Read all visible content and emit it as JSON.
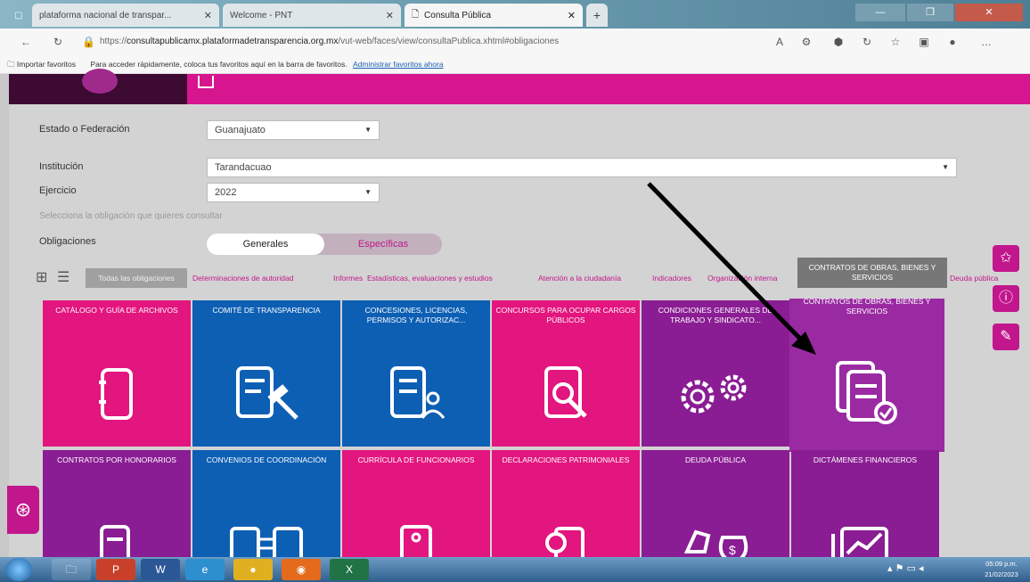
{
  "browser": {
    "tabs": [
      {
        "label": "plataforma nacional de transpar..."
      },
      {
        "label": "Welcome - PNT"
      },
      {
        "label": "Consulta Pública"
      }
    ],
    "url_prefix": "https://",
    "url_domain": "consultapublicamx.plataformadetransparencia.org.mx",
    "url_path": "/vut-web/faces/view/consultaPublica.xhtml#obligaciones",
    "favorites_import": "Importar favoritos",
    "favorites_hint": "Para acceder rápidamente, coloca tus favoritos aquí en la barra de favoritos.",
    "favorites_link": "Administrar favoritos ahora"
  },
  "form": {
    "estado_label": "Estado o Federación",
    "estado_value": "Guanajuato",
    "institucion_label": "Institución",
    "institucion_value": "Tarandacuao",
    "ejercicio_label": "Ejercicio",
    "ejercicio_value": "2022",
    "hint": "Selecciona la obligación que quieres consultar",
    "obligaciones_label": "Obligaciones",
    "toggle_on": "Generales",
    "toggle_off": "Específicas"
  },
  "filters": {
    "all": "Todas las obligaciones",
    "items": [
      "Determinaciones de autoridad",
      "Informes",
      "Estadísticas, evaluaciones y estudios",
      "Atención a la ciudadanía",
      "Indicadores",
      "Organización interna"
    ],
    "last": "Deuda pública"
  },
  "tooltip": "CONTRATOS DE OBRAS, BIENES Y SERVICIOS",
  "tiles_row1": [
    {
      "label": "CATÁLOGO Y GUÍA DE ARCHIVOS",
      "color": "#e3157e",
      "icon": "binder-icon"
    },
    {
      "label": "COMITÉ DE TRANSPARENCIA",
      "color": "#0d5fb4",
      "icon": "gavel-document-icon"
    },
    {
      "label": "CONCESIONES, LICENCIAS, PERMISOS Y AUTORIZAC...",
      "color": "#0d5fb4",
      "icon": "document-person-icon"
    },
    {
      "label": "CONCURSOS PARA OCUPAR CARGOS PÚBLICOS",
      "color": "#e3157e",
      "icon": "search-person-icon"
    },
    {
      "label": "CONDICIONES GENERALES DE TRABAJO Y SINDICATO...",
      "color": "#8a1d93",
      "icon": "gears-icon"
    },
    {
      "label": "CONTRATOS DE OBRAS, BIENES Y SERVICIOS",
      "color": "#9a2aa2",
      "icon": "documents-check-icon"
    }
  ],
  "tiles_row2": [
    {
      "label": "CONTRATOS POR HONORARIOS",
      "color": "#8a1d93"
    },
    {
      "label": "CONVENIOS DE COORDINACIÓN",
      "color": "#0d5fb4"
    },
    {
      "label": "CURRÍCULA DE FUNCIONARIOS",
      "color": "#e3157e"
    },
    {
      "label": "DECLARACIONES PATRIMONIALES",
      "color": "#e3157e"
    },
    {
      "label": "DEUDA PÚBLICA",
      "color": "#8a1d93"
    },
    {
      "label": "DICTÁMENES FINANCIEROS",
      "color": "#8a1d93"
    }
  ],
  "taskbar": {
    "time": "05:09 p.m.",
    "date": "21/02/2023"
  }
}
